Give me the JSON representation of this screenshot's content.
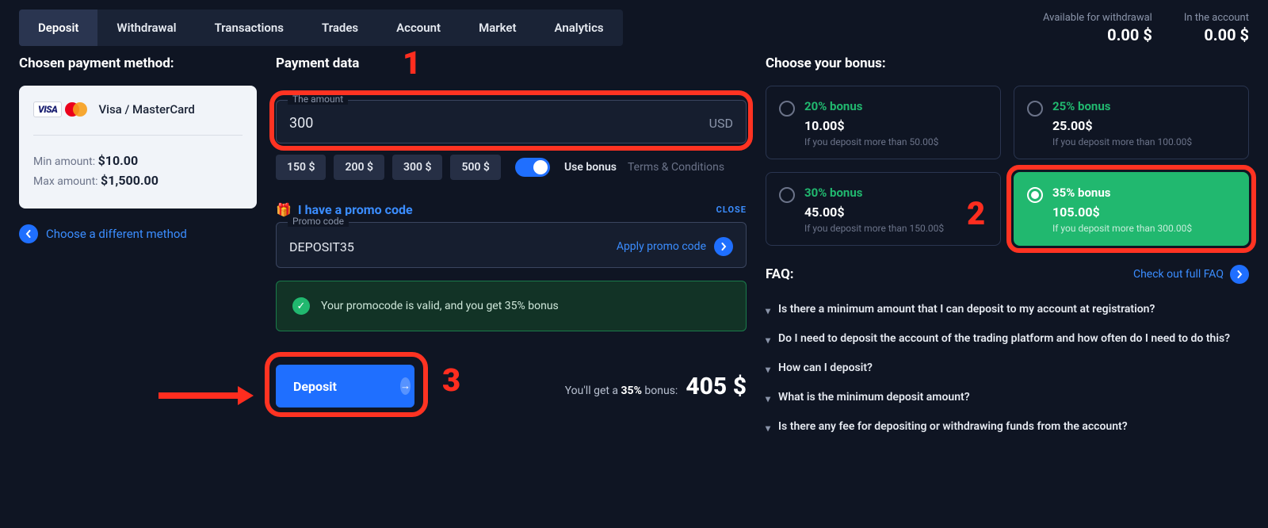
{
  "tabs": [
    "Deposit",
    "Withdrawal",
    "Transactions",
    "Trades",
    "Account",
    "Market",
    "Analytics"
  ],
  "active_tab": 0,
  "balances": {
    "withdraw_label": "Available for withdrawal",
    "withdraw_value": "0.00 $",
    "account_label": "In the account",
    "account_value": "0.00 $"
  },
  "left": {
    "title": "Chosen payment method:",
    "method_name": "Visa / MasterCard",
    "min_label": "Min amount:",
    "min_value": "$10.00",
    "max_label": "Max amount:",
    "max_value": "$1,500.00",
    "choose_diff": "Choose a different method"
  },
  "mid": {
    "title": "Payment data",
    "amount_legend": "The amount",
    "amount_value": "300",
    "currency": "USD",
    "chips": [
      "150 $",
      "200 $",
      "300 $",
      "500 $"
    ],
    "use_bonus": "Use bonus",
    "terms": "Terms & Conditions",
    "promo_title": "I have a promo code",
    "close": "CLOSE",
    "promo_legend": "Promo code",
    "promo_value": "DEPOSIT35",
    "apply": "Apply promo code",
    "promo_success": "Your promocode is valid, and you get 35% bonus",
    "deposit_btn": "Deposit",
    "youget_prefix": "You'll get a ",
    "youget_pct": "35%",
    "youget_suffix": " bonus:",
    "total": "405 $"
  },
  "right": {
    "title": "Choose your bonus:",
    "bonuses": [
      {
        "name": "20% bonus",
        "amount": "10.00$",
        "cond": "If you deposit more than 50.00$"
      },
      {
        "name": "25% bonus",
        "amount": "25.00$",
        "cond": "If you deposit more than 100.00$"
      },
      {
        "name": "30% bonus",
        "amount": "45.00$",
        "cond": "If you deposit more than 150.00$"
      },
      {
        "name": "35% bonus",
        "amount": "105.00$",
        "cond": "If you deposit more than 300.00$"
      }
    ],
    "selected_bonus": 3,
    "faq_title": "FAQ:",
    "faq_link": "Check out full FAQ",
    "faq": [
      "Is there a minimum amount that I can deposit to my account at registration?",
      "Do I need to deposit the account of the trading platform and how often do I need to do this?",
      "How can I deposit?",
      "What is the minimum deposit amount?",
      "Is there any fee for depositing or withdrawing funds from the account?"
    ]
  },
  "annotations": {
    "n1": "1",
    "n2": "2",
    "n3": "3"
  }
}
